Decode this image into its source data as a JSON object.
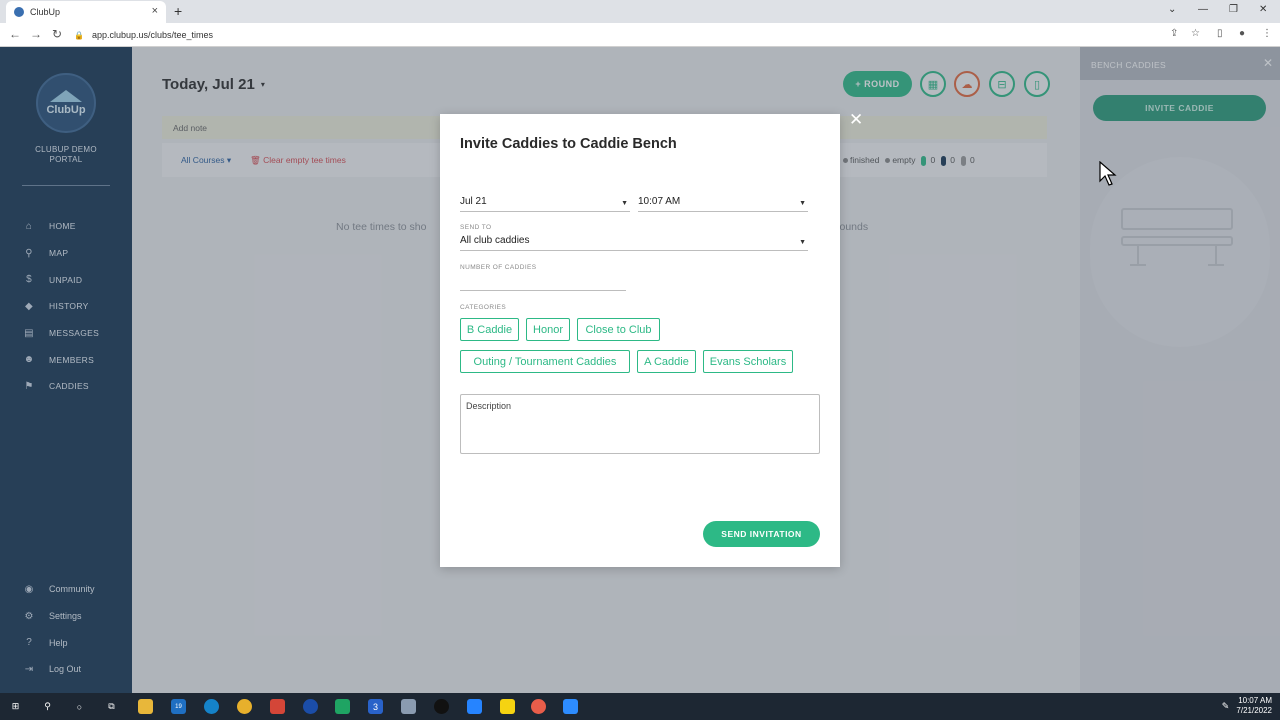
{
  "browser": {
    "tab_title": "ClubUp",
    "tab_close": "×",
    "new_tab": "+",
    "url": "app.clubup.us/clubs/tee_times",
    "back": "←",
    "forward": "→",
    "reload": "↻",
    "lock": "🔒",
    "minimize": "—",
    "restore": "❐",
    "close": "✕",
    "tabs_menu": "⌄",
    "star": "☆",
    "share": "⇪",
    "sidebar_toggle": "▯",
    "profile": "●",
    "menu": "⋮"
  },
  "sidebar": {
    "logo_text": "ClubUp",
    "portal_line1": "CLUBUP DEMO",
    "portal_line2": "PORTAL",
    "items": [
      {
        "label": "HOME",
        "icon": "⌂"
      },
      {
        "label": "MAP",
        "icon": "⚲"
      },
      {
        "label": "UNPAID",
        "icon": "$"
      },
      {
        "label": "HISTORY",
        "icon": "◆"
      },
      {
        "label": "MESSAGES",
        "icon": "▤"
      },
      {
        "label": "MEMBERS",
        "icon": "☻"
      },
      {
        "label": "CADDIES",
        "icon": "⚑"
      }
    ],
    "bottom_items": [
      {
        "label": "Community",
        "icon": "◉"
      },
      {
        "label": "Settings",
        "icon": "⚙"
      },
      {
        "label": "Help",
        "icon": "?"
      },
      {
        "label": "Log Out",
        "icon": "⇥"
      }
    ]
  },
  "main": {
    "date_title": "Today, Jul 21",
    "date_caret": "▾",
    "round_button": "+ ROUND",
    "add_note": "Add note",
    "all_courses": "All Courses ▾",
    "clear_empty": "🗑 Clear empty tee times",
    "legend_finished": "finished",
    "legend_empty": "empty",
    "count_green": "0",
    "count_navy": "0",
    "count_gray": "0",
    "no_tee_times": "No tee times to sho",
    "rounds_text": "rounds"
  },
  "right_panel": {
    "title": "BENCH CADDIES",
    "close": "✕",
    "invite_caddie": "INVITE CADDIE"
  },
  "modal": {
    "title": "Invite Caddies to Caddie Bench",
    "close": "✕",
    "date_value": "Jul 21",
    "time_value": "10:07 AM",
    "send_to_label": "SEND TO",
    "send_to_value": "All club caddies",
    "num_caddies_label": "NUMBER OF CADDIES",
    "num_caddies_value": "",
    "categories_label": "CATEGORIES",
    "categories": [
      "B Caddie",
      "Honor",
      "Close to Club",
      "Outing / Tournament Caddies",
      "A Caddie",
      "Evans Scholars"
    ],
    "description_placeholder": "Description",
    "send_button": "SEND INVITATION"
  },
  "taskbar": {
    "time": "10:07 AM",
    "date": "7/21/2022",
    "mail_badge": "19",
    "calendar_day": "3"
  },
  "colors": {
    "accent_green": "#2db986",
    "sidebar_navy": "#173654",
    "danger_red": "#d64b52",
    "orange": "#e2673c"
  }
}
